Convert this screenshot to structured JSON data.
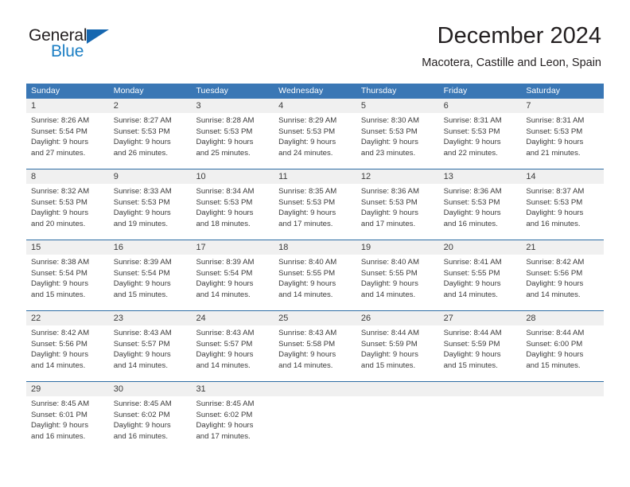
{
  "brand": {
    "name_part1": "General",
    "name_part2": "Blue",
    "accent_color": "#1c7fc4",
    "triangle_color": "#1667b0"
  },
  "header": {
    "month_title": "December 2024",
    "location": "Macotera, Castille and Leon, Spain",
    "header_bg_color": "#3a77b5",
    "row_divider_color": "#2e6da4",
    "daynum_bg_color": "#f0f0f0"
  },
  "weekday_headers": [
    "Sunday",
    "Monday",
    "Tuesday",
    "Wednesday",
    "Thursday",
    "Friday",
    "Saturday"
  ],
  "weeks": [
    {
      "days": [
        {
          "num": "1",
          "sunrise": "Sunrise: 8:26 AM",
          "sunset": "Sunset: 5:54 PM",
          "daylight1": "Daylight: 9 hours",
          "daylight2": "and 27 minutes."
        },
        {
          "num": "2",
          "sunrise": "Sunrise: 8:27 AM",
          "sunset": "Sunset: 5:53 PM",
          "daylight1": "Daylight: 9 hours",
          "daylight2": "and 26 minutes."
        },
        {
          "num": "3",
          "sunrise": "Sunrise: 8:28 AM",
          "sunset": "Sunset: 5:53 PM",
          "daylight1": "Daylight: 9 hours",
          "daylight2": "and 25 minutes."
        },
        {
          "num": "4",
          "sunrise": "Sunrise: 8:29 AM",
          "sunset": "Sunset: 5:53 PM",
          "daylight1": "Daylight: 9 hours",
          "daylight2": "and 24 minutes."
        },
        {
          "num": "5",
          "sunrise": "Sunrise: 8:30 AM",
          "sunset": "Sunset: 5:53 PM",
          "daylight1": "Daylight: 9 hours",
          "daylight2": "and 23 minutes."
        },
        {
          "num": "6",
          "sunrise": "Sunrise: 8:31 AM",
          "sunset": "Sunset: 5:53 PM",
          "daylight1": "Daylight: 9 hours",
          "daylight2": "and 22 minutes."
        },
        {
          "num": "7",
          "sunrise": "Sunrise: 8:31 AM",
          "sunset": "Sunset: 5:53 PM",
          "daylight1": "Daylight: 9 hours",
          "daylight2": "and 21 minutes."
        }
      ]
    },
    {
      "days": [
        {
          "num": "8",
          "sunrise": "Sunrise: 8:32 AM",
          "sunset": "Sunset: 5:53 PM",
          "daylight1": "Daylight: 9 hours",
          "daylight2": "and 20 minutes."
        },
        {
          "num": "9",
          "sunrise": "Sunrise: 8:33 AM",
          "sunset": "Sunset: 5:53 PM",
          "daylight1": "Daylight: 9 hours",
          "daylight2": "and 19 minutes."
        },
        {
          "num": "10",
          "sunrise": "Sunrise: 8:34 AM",
          "sunset": "Sunset: 5:53 PM",
          "daylight1": "Daylight: 9 hours",
          "daylight2": "and 18 minutes."
        },
        {
          "num": "11",
          "sunrise": "Sunrise: 8:35 AM",
          "sunset": "Sunset: 5:53 PM",
          "daylight1": "Daylight: 9 hours",
          "daylight2": "and 17 minutes."
        },
        {
          "num": "12",
          "sunrise": "Sunrise: 8:36 AM",
          "sunset": "Sunset: 5:53 PM",
          "daylight1": "Daylight: 9 hours",
          "daylight2": "and 17 minutes."
        },
        {
          "num": "13",
          "sunrise": "Sunrise: 8:36 AM",
          "sunset": "Sunset: 5:53 PM",
          "daylight1": "Daylight: 9 hours",
          "daylight2": "and 16 minutes."
        },
        {
          "num": "14",
          "sunrise": "Sunrise: 8:37 AM",
          "sunset": "Sunset: 5:53 PM",
          "daylight1": "Daylight: 9 hours",
          "daylight2": "and 16 minutes."
        }
      ]
    },
    {
      "days": [
        {
          "num": "15",
          "sunrise": "Sunrise: 8:38 AM",
          "sunset": "Sunset: 5:54 PM",
          "daylight1": "Daylight: 9 hours",
          "daylight2": "and 15 minutes."
        },
        {
          "num": "16",
          "sunrise": "Sunrise: 8:39 AM",
          "sunset": "Sunset: 5:54 PM",
          "daylight1": "Daylight: 9 hours",
          "daylight2": "and 15 minutes."
        },
        {
          "num": "17",
          "sunrise": "Sunrise: 8:39 AM",
          "sunset": "Sunset: 5:54 PM",
          "daylight1": "Daylight: 9 hours",
          "daylight2": "and 14 minutes."
        },
        {
          "num": "18",
          "sunrise": "Sunrise: 8:40 AM",
          "sunset": "Sunset: 5:55 PM",
          "daylight1": "Daylight: 9 hours",
          "daylight2": "and 14 minutes."
        },
        {
          "num": "19",
          "sunrise": "Sunrise: 8:40 AM",
          "sunset": "Sunset: 5:55 PM",
          "daylight1": "Daylight: 9 hours",
          "daylight2": "and 14 minutes."
        },
        {
          "num": "20",
          "sunrise": "Sunrise: 8:41 AM",
          "sunset": "Sunset: 5:55 PM",
          "daylight1": "Daylight: 9 hours",
          "daylight2": "and 14 minutes."
        },
        {
          "num": "21",
          "sunrise": "Sunrise: 8:42 AM",
          "sunset": "Sunset: 5:56 PM",
          "daylight1": "Daylight: 9 hours",
          "daylight2": "and 14 minutes."
        }
      ]
    },
    {
      "days": [
        {
          "num": "22",
          "sunrise": "Sunrise: 8:42 AM",
          "sunset": "Sunset: 5:56 PM",
          "daylight1": "Daylight: 9 hours",
          "daylight2": "and 14 minutes."
        },
        {
          "num": "23",
          "sunrise": "Sunrise: 8:43 AM",
          "sunset": "Sunset: 5:57 PM",
          "daylight1": "Daylight: 9 hours",
          "daylight2": "and 14 minutes."
        },
        {
          "num": "24",
          "sunrise": "Sunrise: 8:43 AM",
          "sunset": "Sunset: 5:57 PM",
          "daylight1": "Daylight: 9 hours",
          "daylight2": "and 14 minutes."
        },
        {
          "num": "25",
          "sunrise": "Sunrise: 8:43 AM",
          "sunset": "Sunset: 5:58 PM",
          "daylight1": "Daylight: 9 hours",
          "daylight2": "and 14 minutes."
        },
        {
          "num": "26",
          "sunrise": "Sunrise: 8:44 AM",
          "sunset": "Sunset: 5:59 PM",
          "daylight1": "Daylight: 9 hours",
          "daylight2": "and 15 minutes."
        },
        {
          "num": "27",
          "sunrise": "Sunrise: 8:44 AM",
          "sunset": "Sunset: 5:59 PM",
          "daylight1": "Daylight: 9 hours",
          "daylight2": "and 15 minutes."
        },
        {
          "num": "28",
          "sunrise": "Sunrise: 8:44 AM",
          "sunset": "Sunset: 6:00 PM",
          "daylight1": "Daylight: 9 hours",
          "daylight2": "and 15 minutes."
        }
      ]
    },
    {
      "days": [
        {
          "num": "29",
          "sunrise": "Sunrise: 8:45 AM",
          "sunset": "Sunset: 6:01 PM",
          "daylight1": "Daylight: 9 hours",
          "daylight2": "and 16 minutes."
        },
        {
          "num": "30",
          "sunrise": "Sunrise: 8:45 AM",
          "sunset": "Sunset: 6:02 PM",
          "daylight1": "Daylight: 9 hours",
          "daylight2": "and 16 minutes."
        },
        {
          "num": "31",
          "sunrise": "Sunrise: 8:45 AM",
          "sunset": "Sunset: 6:02 PM",
          "daylight1": "Daylight: 9 hours",
          "daylight2": "and 17 minutes."
        },
        {
          "num": "",
          "sunrise": "",
          "sunset": "",
          "daylight1": "",
          "daylight2": ""
        },
        {
          "num": "",
          "sunrise": "",
          "sunset": "",
          "daylight1": "",
          "daylight2": ""
        },
        {
          "num": "",
          "sunrise": "",
          "sunset": "",
          "daylight1": "",
          "daylight2": ""
        },
        {
          "num": "",
          "sunrise": "",
          "sunset": "",
          "daylight1": "",
          "daylight2": ""
        }
      ]
    }
  ]
}
